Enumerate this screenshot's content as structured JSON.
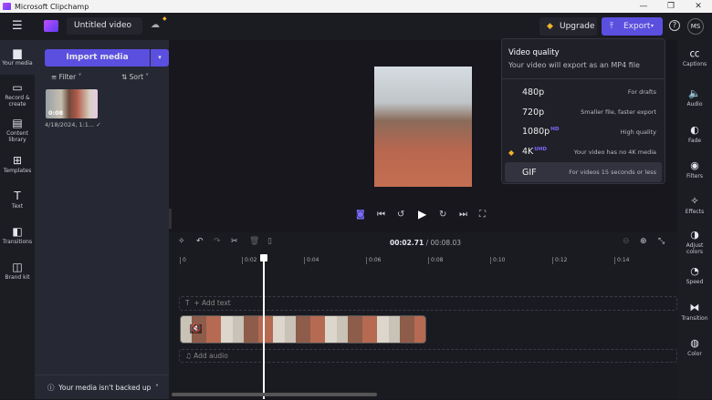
{
  "window": {
    "title": "Microsoft Clipchamp",
    "minimize": "—",
    "maximize": "❐",
    "close": "✕"
  },
  "header": {
    "project_name": "Untitled video",
    "upgrade_label": "Upgrade",
    "export_label": "Export",
    "help": "?",
    "avatar": "MS"
  },
  "left_nav": [
    {
      "label": "Your media",
      "icon": "▆"
    },
    {
      "label": "Record & create",
      "icon": "▭"
    },
    {
      "label": "Content library",
      "icon": "▤"
    },
    {
      "label": "Templates",
      "icon": "⊞"
    },
    {
      "label": "Text",
      "icon": "T"
    },
    {
      "label": "Transitions",
      "icon": "◧"
    },
    {
      "label": "Brand kit",
      "icon": "◫"
    }
  ],
  "media": {
    "import_label": "Import media",
    "filter_label": "Filter",
    "sort_label": "Sort",
    "items": [
      {
        "duration": "0:08",
        "name": "4/18/2024, 1:1...",
        "status": "✓"
      }
    ],
    "backup_notice": "Your media isn't backed up"
  },
  "export_menu": {
    "title": "Video quality",
    "subtitle": "Your video will export as an MP4 file",
    "options": [
      {
        "quality": "480p",
        "badge": "",
        "description": "For drafts"
      },
      {
        "quality": "720p",
        "badge": "",
        "description": "Smaller file, faster export"
      },
      {
        "quality": "1080p",
        "badge": "HD",
        "description": "High quality"
      },
      {
        "quality": "4K",
        "badge": "UHD",
        "description": "Your video has no 4K media",
        "premium": true
      },
      {
        "quality": "GIF",
        "badge": "",
        "description": "For videos 15 seconds or less",
        "selected": true
      }
    ]
  },
  "right_nav": [
    {
      "label": "Captions",
      "icon": "㏄"
    },
    {
      "label": "Audio",
      "icon": "🔈"
    },
    {
      "label": "Fade",
      "icon": "◐"
    },
    {
      "label": "Filters",
      "icon": "◉"
    },
    {
      "label": "Effects",
      "icon": "✧"
    },
    {
      "label": "Adjust colors",
      "icon": "◑"
    },
    {
      "label": "Speed",
      "icon": "◔"
    },
    {
      "label": "Transition",
      "icon": "⧓"
    },
    {
      "label": "Color",
      "icon": "◍"
    }
  ],
  "timeline": {
    "current_time": "00:02.71",
    "total_time": "/ 00:08.03",
    "ticks": [
      "0",
      "0:02",
      "0:04",
      "0:06",
      "0:08",
      "0:10",
      "0:12",
      "0:14"
    ],
    "add_text": "+ Add text",
    "add_audio": "Add audio",
    "playhead_seconds": 2.71
  },
  "colors": {
    "accent": "#5b4fe0",
    "premium": "#f0b429"
  }
}
